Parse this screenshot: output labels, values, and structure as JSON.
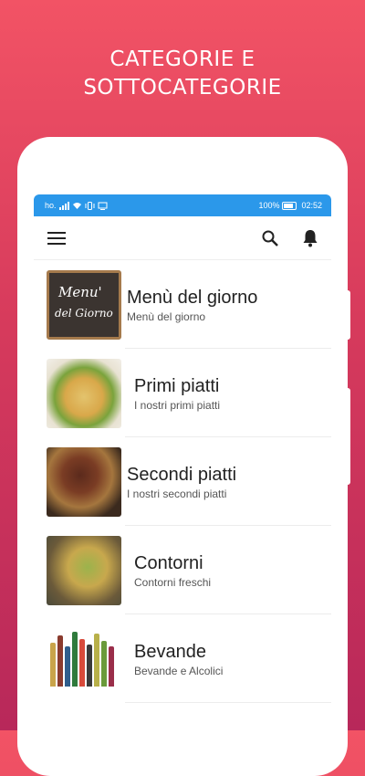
{
  "promo": {
    "line1": "CATEGORIE E",
    "line2": "SOTTOCATEGORIE"
  },
  "status_bar": {
    "carrier": "ho.",
    "battery": "100%",
    "time": "02:52",
    "color": "#2b98ea"
  },
  "app_bar": {
    "menu_icon": "hamburger-menu-icon",
    "search_icon": "search-icon",
    "bell_icon": "bell-icon"
  },
  "categories": [
    {
      "title": "Menù del giorno",
      "subtitle": "Menù del giorno",
      "image": "chalkboard",
      "chalk_line1": "Menu'",
      "chalk_line2": "del Giorno"
    },
    {
      "title": "Primi piatti",
      "subtitle": "I nostri primi piatti",
      "image": "pasta"
    },
    {
      "title": "Secondi piatti",
      "subtitle": "I nostri secondi piatti",
      "image": "steak"
    },
    {
      "title": "Contorni",
      "subtitle": "Contorni freschi",
      "image": "vegetables"
    },
    {
      "title": "Bevande",
      "subtitle": "Bevande e Alcolici",
      "image": "bottles"
    }
  ],
  "colors": {
    "background_top": "#f25365",
    "background_bottom": "#b8285a",
    "accent": "#2b98ea"
  }
}
